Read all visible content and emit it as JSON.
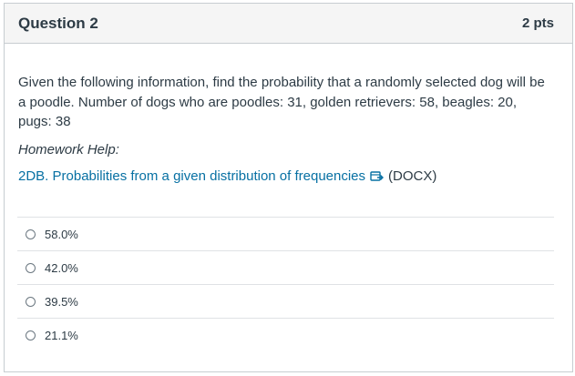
{
  "question": {
    "title": "Question 2",
    "points": "2 pts",
    "text": "Given the following information, find the probability that a randomly selected dog will be a poodle. Number of dogs who are poodles: 31, golden retrievers: 58, beagles: 20, pugs: 38",
    "help_heading": "Homework Help:",
    "help_link_text": "2DB. Probabilities from a given distribution of frequencies",
    "help_link_suffix": "(DOCX)",
    "help_link_icon": "external-link-icon"
  },
  "answers": [
    {
      "label": "58.0%",
      "selected": false
    },
    {
      "label": "42.0%",
      "selected": false
    },
    {
      "label": "39.5%",
      "selected": false
    },
    {
      "label": "21.1%",
      "selected": false
    }
  ],
  "colors": {
    "link": "#0770a3",
    "text": "#2d3b45",
    "border": "#c7cdd1",
    "header_bg": "#f5f5f5"
  }
}
